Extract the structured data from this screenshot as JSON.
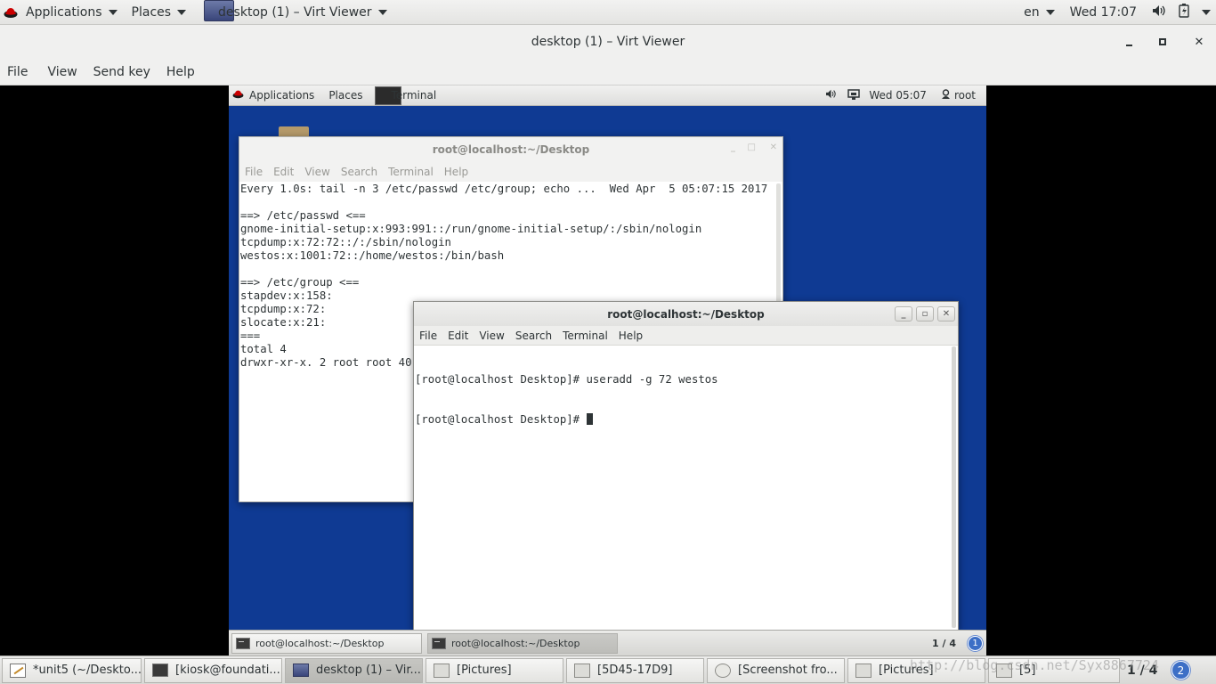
{
  "host_topbar": {
    "applications": "Applications",
    "places": "Places",
    "app_menu": "desktop (1) – Virt Viewer",
    "lang": "en",
    "clock": "Wed 17:07"
  },
  "window": {
    "title": "desktop (1) – Virt Viewer",
    "menu": [
      "File",
      "View",
      "Send key",
      "Help"
    ]
  },
  "guest_topbar": {
    "applications": "Applications",
    "places": "Places",
    "app": "Terminal",
    "clock": "Wed 05:07",
    "user": "root"
  },
  "terminal_back": {
    "title": "root@localhost:~/Desktop",
    "menu": [
      "File",
      "Edit",
      "View",
      "Search",
      "Terminal",
      "Help"
    ],
    "lines": [
      "Every 1.0s: tail -n 3 /etc/passwd /etc/group; echo ...  Wed Apr  5 05:07:15 2017",
      "",
      "==> /etc/passwd <==",
      "gnome-initial-setup:x:993:991::/run/gnome-initial-setup/:/sbin/nologin",
      "tcpdump:x:72:72::/:/sbin/nologin",
      "westos:x:1001:72::/home/westos:/bin/bash",
      "",
      "==> /etc/group <==",
      "stapdev:x:158:",
      "tcpdump:x:72:",
      "slocate:x:21:",
      "===",
      "total 4",
      "drwxr-xr-x. 2 root root 40"
    ]
  },
  "terminal_front": {
    "title": "root@localhost:~/Desktop",
    "menu": [
      "File",
      "Edit",
      "View",
      "Search",
      "Terminal",
      "Help"
    ],
    "lines": [
      "[root@localhost Desktop]# useradd -g 72 westos",
      "[root@localhost Desktop]# "
    ]
  },
  "guest_taskbar": {
    "tasks": [
      "root@localhost:~/Desktop",
      "root@localhost:~/Desktop"
    ],
    "workspace": "1 / 4",
    "badge": "1"
  },
  "host_taskbar": {
    "tasks": [
      "*unit5 (~/Deskto...",
      "[kiosk@foundati...",
      "desktop (1) – Vir...",
      "[Pictures]",
      "[5D45-17D9]",
      "[Screenshot fro...",
      "[Pictures]",
      "[5]"
    ],
    "workspace": "1 / 4",
    "badge": "2"
  },
  "watermark": "http://blog.csdn.net/Syx8867724"
}
